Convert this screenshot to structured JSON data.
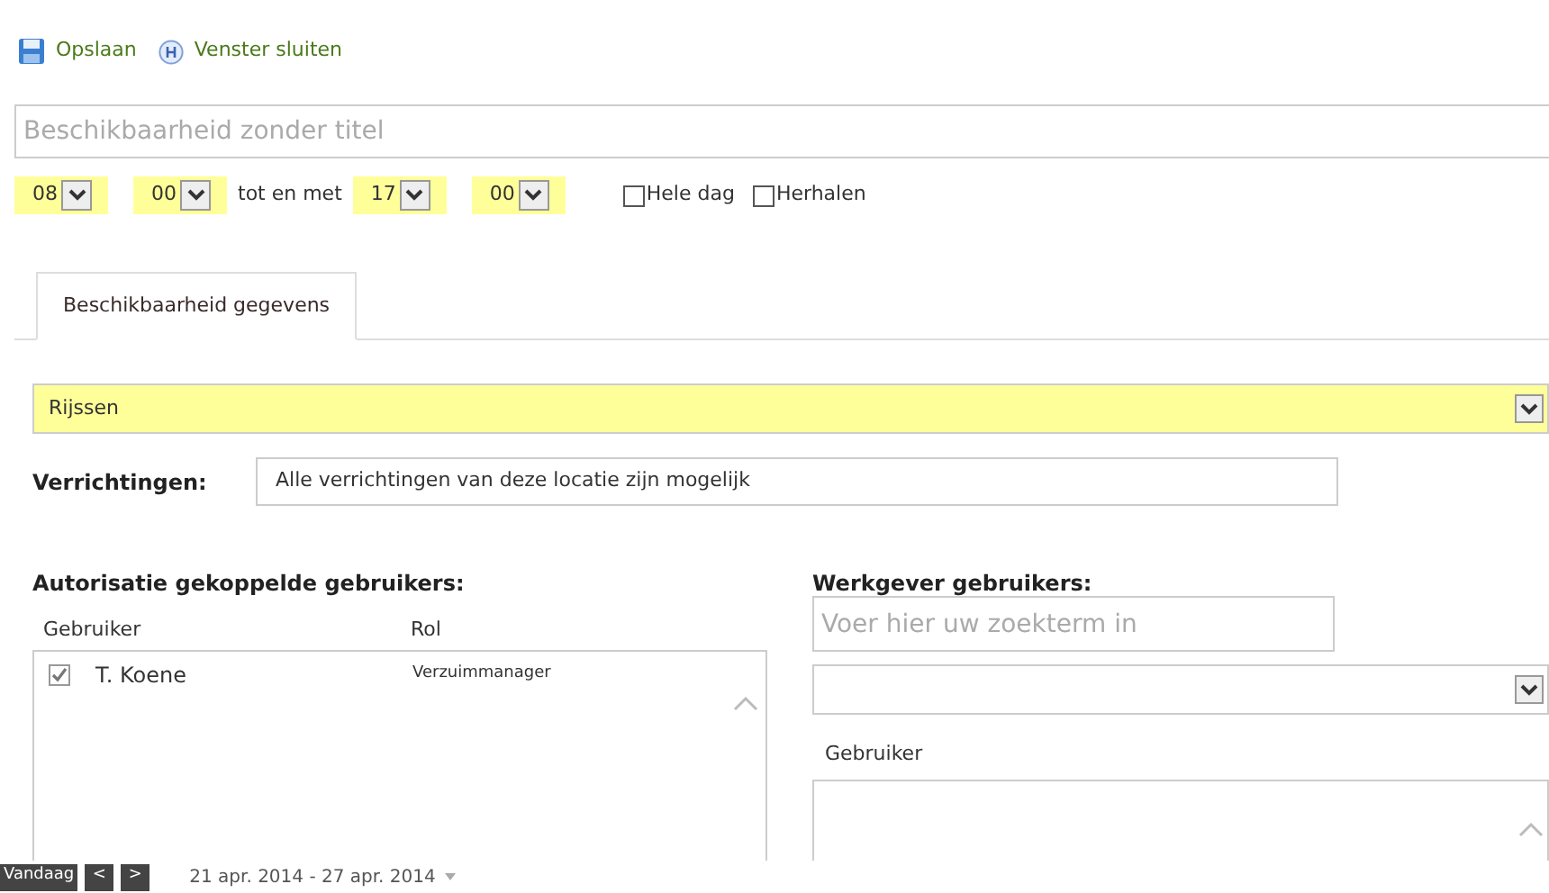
{
  "toolbar": [
    {
      "kind": "save",
      "label": "Opslaan"
    },
    {
      "kind": "close",
      "label": "Venster sluiten"
    }
  ],
  "title_field": {
    "placeholder": "Beschikbaarheid zonder titel"
  },
  "time": {
    "start_hour": "08",
    "start_minute": "00",
    "separator": "tot en met",
    "end_hour": "17",
    "end_minute": "00"
  },
  "options": [
    {
      "label": "Hele dag",
      "checked": false
    },
    {
      "label": "Herhalen",
      "checked": false
    }
  ],
  "tabs": [
    {
      "label": "Beschikbaarheid gegevens",
      "selected": true
    }
  ],
  "location": {
    "value": "Rijssen"
  },
  "verrichtingen": {
    "label": "Verrichtingen:",
    "value": "Alle verrichtingen van deze locatie zijn mogelijk"
  },
  "authorized_users": {
    "title": "Autorisatie gekoppelde gebruikers:",
    "columns": [
      "Gebruiker",
      "Rol"
    ],
    "rows": [
      {
        "name": "T. Koene",
        "role": "Verzuimmanager",
        "checked": true
      }
    ]
  },
  "employer_users": {
    "title": "Werkgever gebruikers:",
    "search_placeholder": "Voer hier uw zoekterm in",
    "column": "Gebruiker"
  },
  "calendar_bar": {
    "today": "Vandaag",
    "prev": "<",
    "next": ">",
    "range": "21 apr. 2014 - 27 apr. 2014"
  }
}
